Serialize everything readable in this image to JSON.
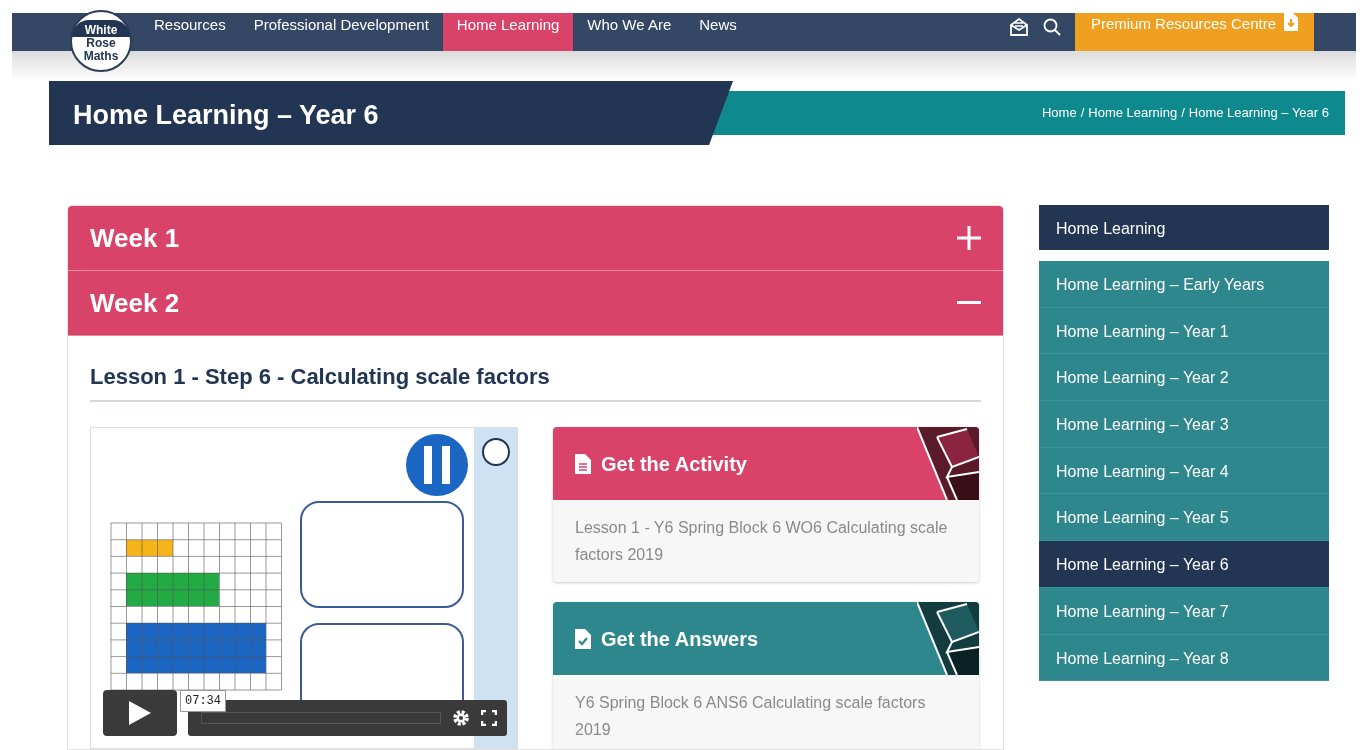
{
  "nav": {
    "logo": [
      "White",
      "Rose",
      "Maths"
    ],
    "items": [
      {
        "label": "Resources",
        "selected": false
      },
      {
        "label": "Professional Development",
        "selected": false
      },
      {
        "label": "Home Learning",
        "selected": true
      },
      {
        "label": "Who We Are",
        "selected": false
      },
      {
        "label": "News",
        "selected": false
      }
    ],
    "premium": "Premium Resources Centre"
  },
  "page_title": "Home Learning – Year 6",
  "breadcrumb": {
    "separator": "/",
    "items": [
      "Home",
      "Home Learning",
      "Home Learning – Year 6"
    ]
  },
  "accordion": [
    {
      "title": "Week 1",
      "expanded": false
    },
    {
      "title": "Week 2",
      "expanded": true
    }
  ],
  "lesson": {
    "title": "Lesson 1 - Step 6 - Calculating scale factors",
    "video": {
      "kind": "picture",
      "time": "07:34"
    }
  },
  "downloads": [
    {
      "kind": "activity",
      "title": "Get the Activity",
      "text": "Lesson 1 - Y6 Spring Block 6 WO6 Calculating scale factors 2019"
    },
    {
      "kind": "answers",
      "title": "Get the Answers",
      "text": "Y6 Spring Block 6 ANS6 Calculating scale factors 2019"
    }
  ],
  "sidebar": {
    "heading": "Home Learning",
    "items": [
      {
        "label": "Home Learning – Early Years",
        "selected": false
      },
      {
        "label": "Home Learning – Year 1",
        "selected": false
      },
      {
        "label": "Home Learning – Year 2",
        "selected": false
      },
      {
        "label": "Home Learning – Year 3",
        "selected": false
      },
      {
        "label": "Home Learning – Year 4",
        "selected": false
      },
      {
        "label": "Home Learning – Year 5",
        "selected": false
      },
      {
        "label": "Home Learning – Year 6",
        "selected": true
      },
      {
        "label": "Home Learning – Year 7",
        "selected": false
      },
      {
        "label": "Home Learning – Year 8",
        "selected": false
      }
    ]
  }
}
